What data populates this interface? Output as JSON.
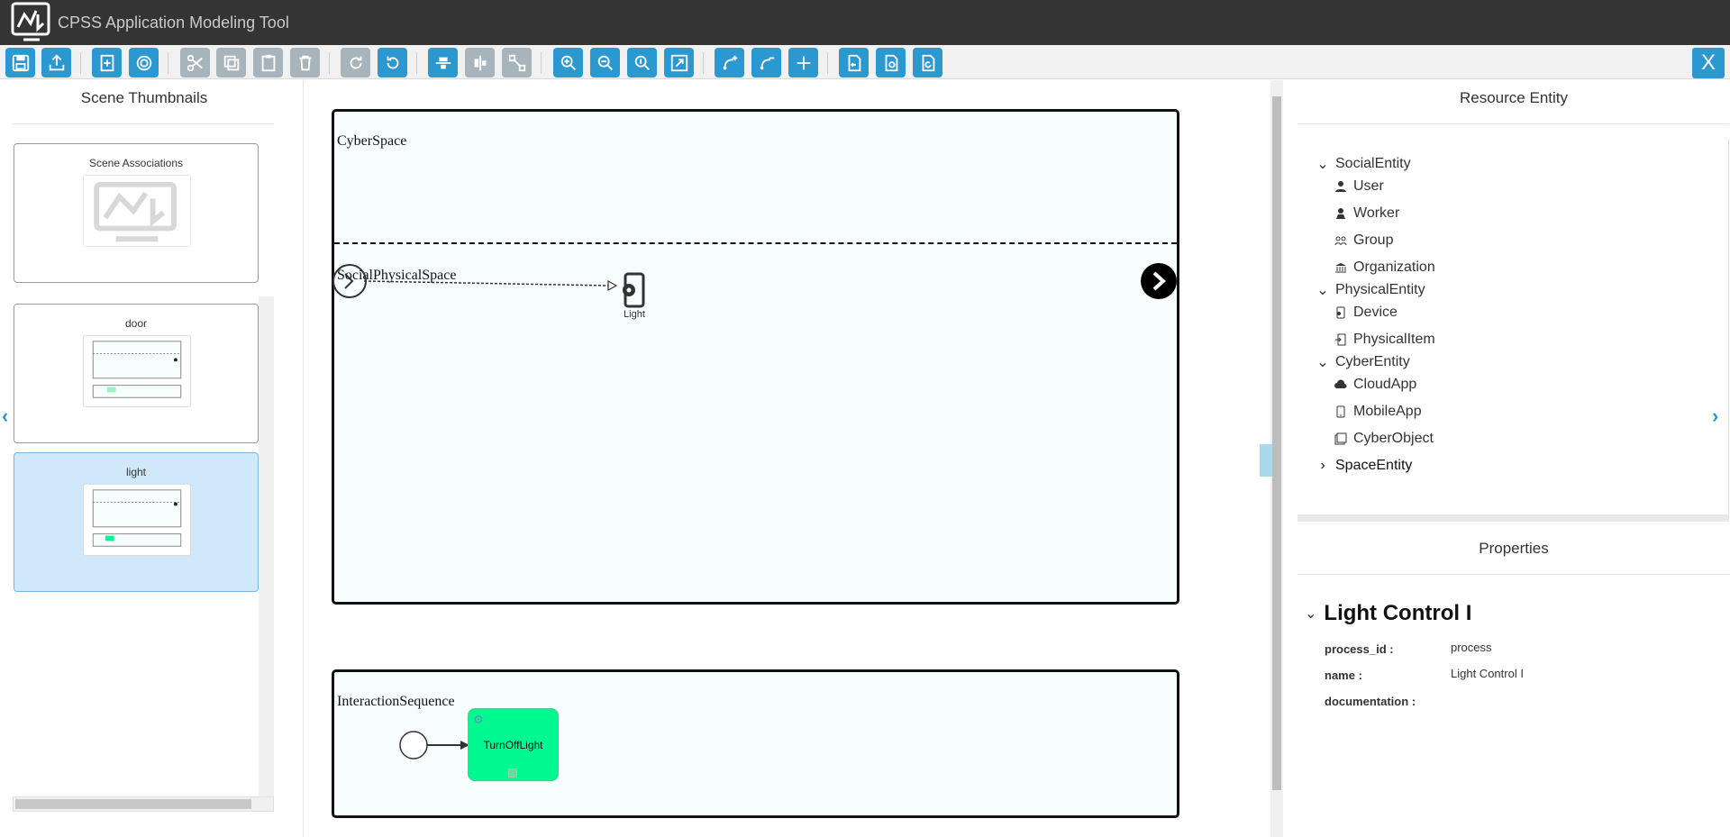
{
  "app": {
    "title": "CPSS Application Modeling Tool",
    "close_label": "X"
  },
  "toolbar": {
    "buttons": [
      "save-icon",
      "export-icon",
      "new-scene-icon",
      "scene-settings-icon",
      "cut-icon",
      "copy-icon",
      "paste-icon",
      "delete-icon",
      "redo-icon",
      "undo-icon",
      "align-top-icon",
      "align-middle-icon",
      "resize-icon",
      "zoom-in-icon",
      "zoom-out-icon",
      "zoom-actual-icon",
      "fit-icon",
      "add-connection-icon",
      "remove-connection-icon",
      "add-icon",
      "import-icon",
      "import-process-icon",
      "refresh-icon"
    ]
  },
  "left_panel": {
    "title": "Scene Thumbnails",
    "scenes": [
      {
        "label": "Scene Associations"
      },
      {
        "label": "door"
      },
      {
        "label": "light"
      }
    ]
  },
  "canvas": {
    "pools": {
      "top": {
        "label": "CyberSpace"
      },
      "lane2": {
        "label": "SocialPhysicalSpace"
      },
      "bottom": {
        "label": "InteractionSequence"
      }
    },
    "nodes": {
      "light": {
        "label": "Light"
      },
      "task": {
        "label": "TurnOffLight",
        "color": "#00f890"
      }
    }
  },
  "right_panel": {
    "resource_title": "Resource Entity",
    "tree": [
      {
        "label": "SocialEntity",
        "expanded": true,
        "children": [
          {
            "label": "User",
            "icon": "user-icon"
          },
          {
            "label": "Worker",
            "icon": "worker-icon"
          },
          {
            "label": "Group",
            "icon": "group-icon"
          },
          {
            "label": "Organization",
            "icon": "organization-icon"
          }
        ]
      },
      {
        "label": "PhysicalEntity",
        "expanded": true,
        "children": [
          {
            "label": "Device",
            "icon": "device-icon"
          },
          {
            "label": "PhysicalItem",
            "icon": "physical-item-icon"
          }
        ]
      },
      {
        "label": "CyberEntity",
        "expanded": true,
        "children": [
          {
            "label": "CloudApp",
            "icon": "cloud-icon"
          },
          {
            "label": "MobileApp",
            "icon": "mobile-icon"
          },
          {
            "label": "CyberObject",
            "icon": "cyber-object-icon"
          }
        ]
      },
      {
        "label": "SpaceEntity",
        "expanded": false,
        "children": []
      }
    ],
    "properties_title": "Properties",
    "properties": {
      "heading": "Light Control I",
      "rows": [
        {
          "key": "process_id :",
          "value": "process"
        },
        {
          "key": "name :",
          "value": "Light Control I"
        },
        {
          "key": "documentation :",
          "value": ""
        }
      ]
    }
  },
  "colors": {
    "accent": "#2b98cf",
    "titlebar": "#343434",
    "selected": "#cfe9fb"
  }
}
